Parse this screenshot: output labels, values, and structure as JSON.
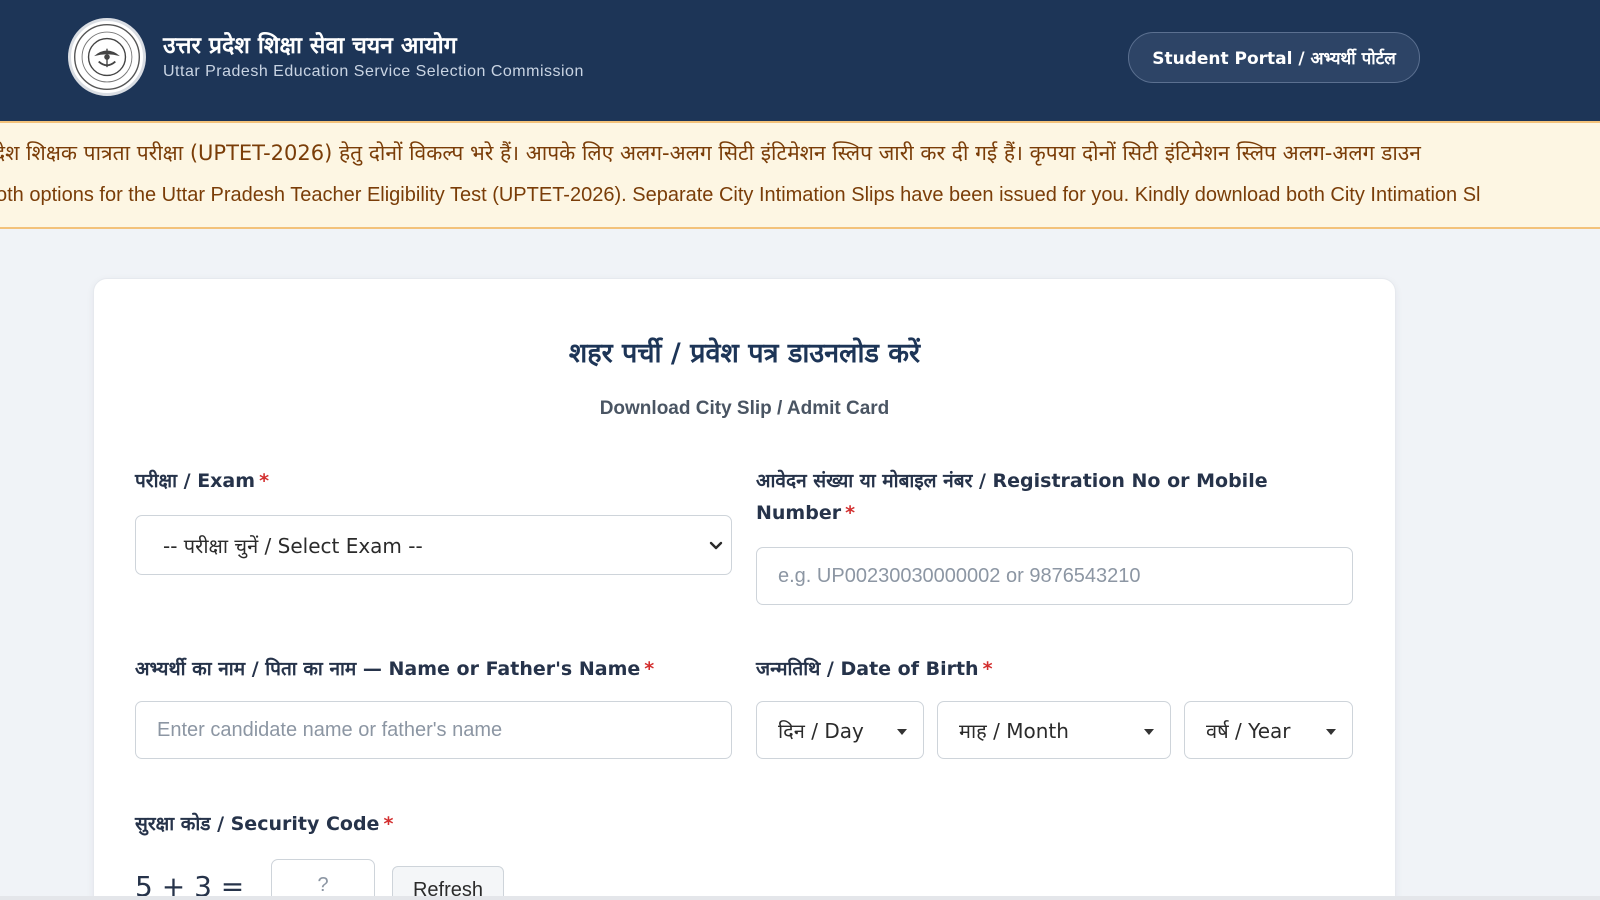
{
  "header": {
    "org_name_hi": "उत्तर प्रदेश शिक्षा सेवा चयन आयोग",
    "org_name_en": "Uttar Pradesh Education Service Selection Commission",
    "portal_button": "Student Portal / अभ्यर्थी पोर्टल",
    "emblem_icon": "up-government-emblem-icon"
  },
  "notice": {
    "line_hi": "देश शिक्षक पात्रता परीक्षा (UPTET-2026) हेतु दोनों विकल्प भरे हैं। आपके लिए अलग-अलग सिटी इंटिमेशन स्लिप जारी कर दी गई हैं। कृपया दोनों सिटी इंटिमेशन स्लिप अलग-अलग डाउन",
    "line_en": "oth options for the Uttar Pradesh Teacher Eligibility Test (UPTET-2026). Separate City Intimation Slips have been issued for you. Kindly download both City Intimation Sl"
  },
  "form": {
    "title": "शहर पर्ची / प्रवेश पत्र डाउनलोड करें",
    "subtitle": "Download City Slip / Admit Card",
    "exam_label": "परीक्षा / Exam",
    "exam_selected": "-- परीक्षा चुनें / Select Exam --",
    "reg_label_line1": "आवेदन संख्या या मोबाइल नंबर / Registration No or Mobile",
    "reg_label_line2": "Number",
    "reg_placeholder": "e.g. UP00230030000002 or 9876543210",
    "name_label": "अभ्यर्थी का नाम / पिता का नाम — Name or Father's Name",
    "name_placeholder": "Enter candidate name or father's name",
    "dob_label": "जन्मतिथि / Date of Birth",
    "dob_day": "दिन / Day",
    "dob_month": "माह / Month",
    "dob_year": "वर्ष / Year",
    "security_label": "सुरक्षा कोड / Security Code",
    "captcha_question": "5 + 3 =",
    "captcha_placeholder": "?",
    "refresh_label": "Refresh",
    "required_mark": "*"
  },
  "colors": {
    "header_bg": "#1d3557",
    "notice_bg": "#fdf6e3",
    "notice_border": "#f3c27a",
    "required": "#d32f2f"
  }
}
